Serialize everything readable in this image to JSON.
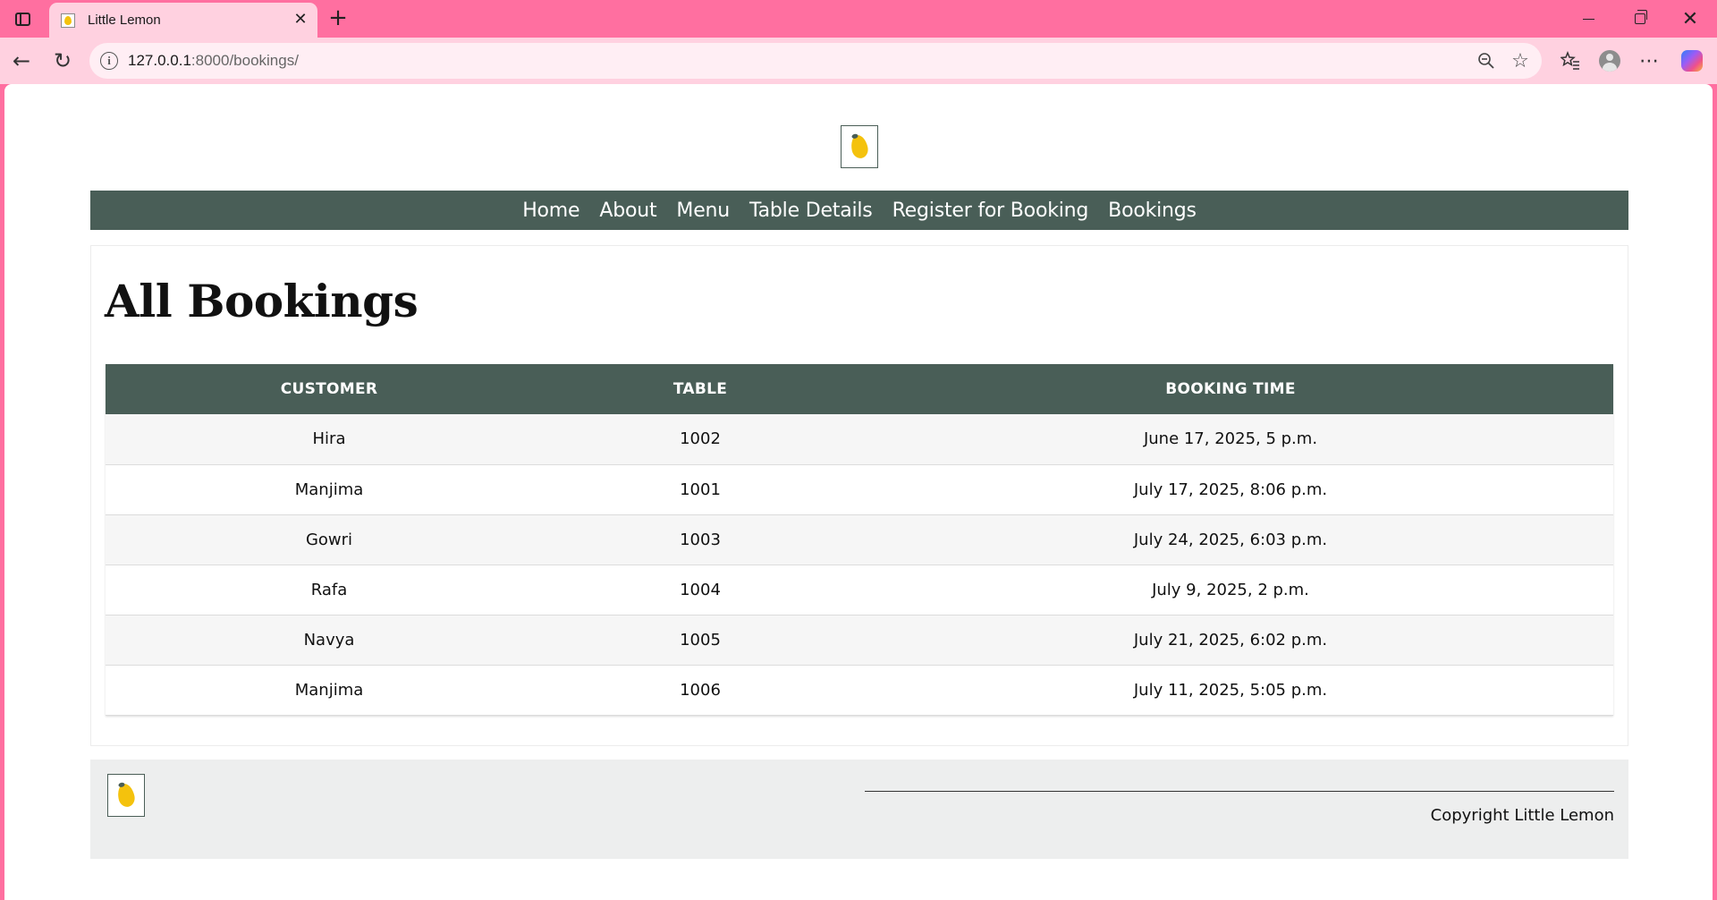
{
  "browser": {
    "tab_title": "Little Lemon",
    "tab_close": "✕",
    "new_tab": "+",
    "url_host": "127.0.0.1",
    "url_rest": ":8000/bookings/",
    "accent_color": "#ff6fa0"
  },
  "nav": {
    "items": [
      "Home",
      "About",
      "Menu",
      "Table Details",
      "Register for Booking",
      "Bookings"
    ]
  },
  "page": {
    "title": "All Bookings"
  },
  "table": {
    "headers": [
      "CUSTOMER",
      "TABLE",
      "BOOKING TIME"
    ],
    "rows": [
      [
        "Hira",
        "1002",
        "June 17, 2025, 5 p.m."
      ],
      [
        "Manjima",
        "1001",
        "July 17, 2025, 8:06 p.m."
      ],
      [
        "Gowri",
        "1003",
        "July 24, 2025, 6:03 p.m."
      ],
      [
        "Rafa",
        "1004",
        "July 9, 2025, 2 p.m."
      ],
      [
        "Navya",
        "1005",
        "July 21, 2025, 6:02 p.m."
      ],
      [
        "Manjima",
        "1006",
        "July 11, 2025, 5:05 p.m."
      ]
    ]
  },
  "footer": {
    "copyright": "Copyright Little Lemon"
  },
  "colors": {
    "brand_green": "#495e57",
    "lemon_yellow": "#f4c20d",
    "footer_bg": "#edeeee"
  }
}
